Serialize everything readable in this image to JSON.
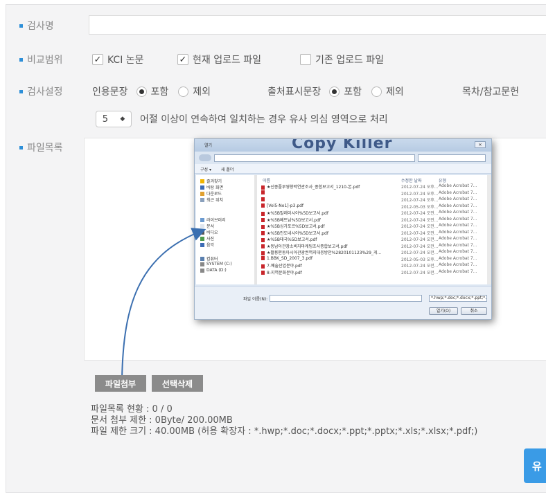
{
  "form": {
    "check_name_label": "검사명",
    "compare_range_label": "비교범위",
    "check_setting_label": "검사설정",
    "file_list_label": "파일목록"
  },
  "compare_range": {
    "kci_label": "KCI 논문",
    "current_upload_label": "현재 업로드 파일",
    "existing_upload_label": "기존 업로드 파일"
  },
  "setting": {
    "citation_label": "인용문장",
    "citation_include": "포함",
    "citation_exclude": "제외",
    "source_label": "출처표시문장",
    "source_include": "포함",
    "source_exclude": "제외",
    "toc_label": "목차/참고문헌",
    "sentence_count": "5",
    "sentence_rule": "어절 이상이 연속하여 일치하는 경우 유사 의심 영역으로 처리"
  },
  "buttons": {
    "attach": "파일첨부",
    "delete_selected": "선택삭제",
    "submit": "유"
  },
  "info": {
    "status": "파일목록 현황 : 0 / 0",
    "attach_limit": "문서 첨부 제한 : 0Byte/ 200.00MB",
    "size_limit": "파일 제한 크기 : 40.00MB (허용 확장자 : *.hwp;*.doc;*.docx;*.ppt;*.pptx;*.xls;*.xlsx;*.pdf;)"
  },
  "dialog": {
    "title": "열기",
    "watermark": "Copy Killer",
    "toolbar_organize": "구성 ▾",
    "toolbar_new_folder": "새 폴더",
    "col_name": "이름",
    "col_date": "수정한 날짜",
    "col_type": "유형",
    "nav": [
      {
        "label": "즐겨찾기",
        "icon": "star-icon"
      },
      {
        "label": "바탕 화면",
        "icon": "desktop-icon"
      },
      {
        "label": "다운로드",
        "icon": "download-icon"
      },
      {
        "label": "최근 위치",
        "icon": "recent-icon"
      },
      {
        "label": "라이브러리",
        "icon": "library-icon"
      },
      {
        "label": "문서",
        "icon": "document-icon"
      },
      {
        "label": "비디오",
        "icon": "video-icon"
      },
      {
        "label": "사진",
        "icon": "picture-icon"
      },
      {
        "label": "음악",
        "icon": "music-icon"
      },
      {
        "label": "컴퓨터",
        "icon": "computer-icon"
      },
      {
        "label": "SYSTEM (C:)",
        "icon": "drive-icon"
      },
      {
        "label": "DATA (D:)",
        "icon": "drive-icon"
      }
    ],
    "files": [
      {
        "name": "★신종플루영향력연관조사_종합보고서_1210-본.pdf",
        "date": "2012-07-24 오후...",
        "type": "Adobe Acrobat 7..."
      },
      {
        "name": "",
        "date": "2012-07-24 오후...",
        "type": "Adobe Acrobat 7..."
      },
      {
        "name": "",
        "date": "2012-07-24 오후...",
        "type": "Adobe Acrobat 7..."
      },
      {
        "name": "[Vol5-No1]-p3.pdf",
        "date": "2012-05-03 오후...",
        "type": "Adobe Acrobat 7..."
      },
      {
        "name": "★%5B말레이시아%5D보고서.pdf",
        "date": "2012-07-24 오전...",
        "type": "Adobe Acrobat 7..."
      },
      {
        "name": "★%5B베트남%5D보고서.pdf",
        "date": "2012-07-24 오전...",
        "type": "Adobe Acrobat 7..."
      },
      {
        "name": "★%5B싱가포르%5D보고서.pdf",
        "date": "2012-07-24 오전...",
        "type": "Adobe Acrobat 7..."
      },
      {
        "name": "★%5B인도네시아%5D보고서.pdf",
        "date": "2012-07-24 오전...",
        "type": "Adobe Acrobat 7..."
      },
      {
        "name": "★%5B태국%5D보고서.pdf",
        "date": "2012-07-24 오전...",
        "type": "Adobe Acrobat 7..."
      },
      {
        "name": "★동남아관광소비자마케팅조사종합보고서.pdf",
        "date": "2012-07-24 오전...",
        "type": "Adobe Acrobat 7..."
      },
      {
        "name": "★활용편동아시아관광권역지대응방안%2820101123%29_게...",
        "date": "2012-07-24 오전...",
        "type": "Adobe Acrobat 7..."
      },
      {
        "name": "1.BBK_SD_2007_3.pdf",
        "date": "2012-05-03 오후...",
        "type": "Adobe Acrobat 7..."
      },
      {
        "name": "7-예술산업분야.pdf",
        "date": "2012-07-24 오전...",
        "type": "Adobe Acrobat 7..."
      },
      {
        "name": "8-지역문화분야.pdf",
        "date": "2012-07-24 오전...",
        "type": "Adobe Acrobat 7..."
      }
    ],
    "filename_label": "파일 이름(N):",
    "filetype": "*.hwp;*.doc;*.docx;*.ppt;*.pptx ▾",
    "open_button": "열기(O)",
    "cancel_button": "취소"
  },
  "colors": {
    "accent": "#2d8fd8",
    "submit_bg": "#3a9be6",
    "dark_button": "#8b8b8b",
    "arrow": "#3b6fb0"
  }
}
